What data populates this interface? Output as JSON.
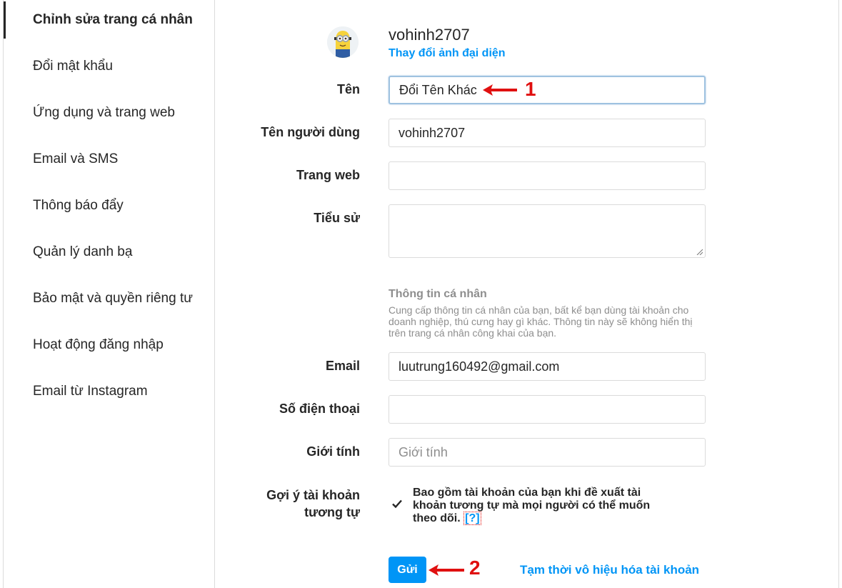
{
  "sidebar": {
    "items": [
      {
        "label": "Chỉnh sửa trang cá nhân"
      },
      {
        "label": "Đổi mật khẩu"
      },
      {
        "label": "Ứng dụng và trang web"
      },
      {
        "label": "Email và SMS"
      },
      {
        "label": "Thông báo đẩy"
      },
      {
        "label": "Quản lý danh bạ"
      },
      {
        "label": "Bảo mật và quyền riêng tư"
      },
      {
        "label": "Hoạt động đăng nhập"
      },
      {
        "label": "Email từ Instagram"
      }
    ]
  },
  "profile": {
    "username": "vohinh2707",
    "change_photo": "Thay đổi ảnh đại diện"
  },
  "form": {
    "name_label": "Tên",
    "name_value": "Đổi Tên Khác",
    "username_label": "Tên người dùng",
    "username_value": "vohinh2707",
    "website_label": "Trang web",
    "website_value": "",
    "bio_label": "Tiểu sử",
    "bio_value": "",
    "personal_info_title": "Thông tin cá nhân",
    "personal_info_desc": "Cung cấp thông tin cá nhân của bạn, bất kể bạn dùng tài khoản cho doanh nghiệp, thú cưng hay gì khác. Thông tin này sẽ không hiển thị trên trang cá nhân công khai của bạn.",
    "email_label": "Email",
    "email_value": "luutrung160492@gmail.com",
    "phone_label": "Số điện thoại",
    "phone_value": "",
    "gender_label": "Giới tính",
    "gender_placeholder": "Giới tính",
    "suggest_label": "Gợi ý tài khoản tương tự",
    "suggest_checked": true,
    "suggest_text": "Bao gồm tài khoản của bạn khi đề xuất tài khoản tương tự mà mọi người có thể muốn theo dõi.",
    "help_link": "[?]",
    "submit_label": "Gửi",
    "disable_label": "Tạm thời vô hiệu hóa tài khoản"
  },
  "annotations": {
    "step1": "1",
    "step2": "2"
  },
  "colors": {
    "accent": "#0095f6",
    "annotation": "#e01010",
    "border": "#dbdbdb"
  }
}
